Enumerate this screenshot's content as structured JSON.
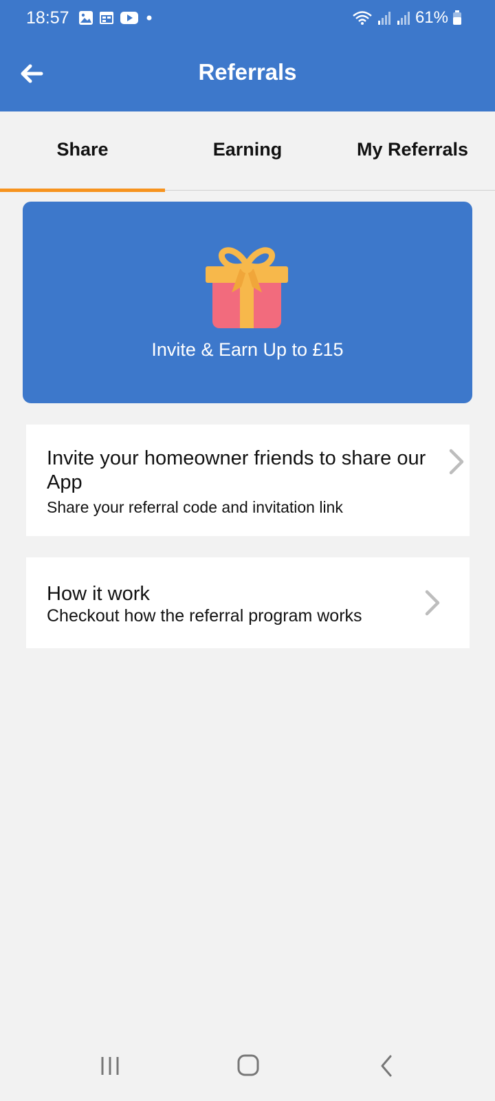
{
  "status_bar": {
    "time": "18:57",
    "battery": "61%",
    "notification_icons": [
      "gallery-icon",
      "calendar-icon",
      "youtube-icon",
      "dot-icon"
    ],
    "system_icons": [
      "wifi-icon",
      "signal-icon",
      "signal-icon",
      "battery-icon"
    ]
  },
  "app_bar": {
    "title": "Referrals",
    "back_icon": "arrow-left-icon"
  },
  "tabs": [
    {
      "label": "Share",
      "active": true
    },
    {
      "label": "Earning",
      "active": false
    },
    {
      "label": "My Referrals",
      "active": false
    }
  ],
  "banner": {
    "icon": "gift-icon",
    "text": "Invite & Earn Up to £15"
  },
  "cards": [
    {
      "title_line1": "Invite your homeowner friends to share our",
      "title_line2": "App",
      "subtitle": "Share your referral code and invitation link",
      "icon": "chevron-right-icon"
    },
    {
      "title": "How it work",
      "subtitle": "Checkout how the referral program works",
      "icon": "chevron-right-icon"
    }
  ],
  "nav_bar": {
    "items": [
      "recents-icon",
      "home-icon",
      "back-icon"
    ]
  },
  "colors": {
    "primary": "#3d78cb",
    "tab_indicator": "#f7931e",
    "background": "#f2f2f2",
    "gift_box": "#f26b7d",
    "gift_ribbon": "#f7b84b"
  }
}
